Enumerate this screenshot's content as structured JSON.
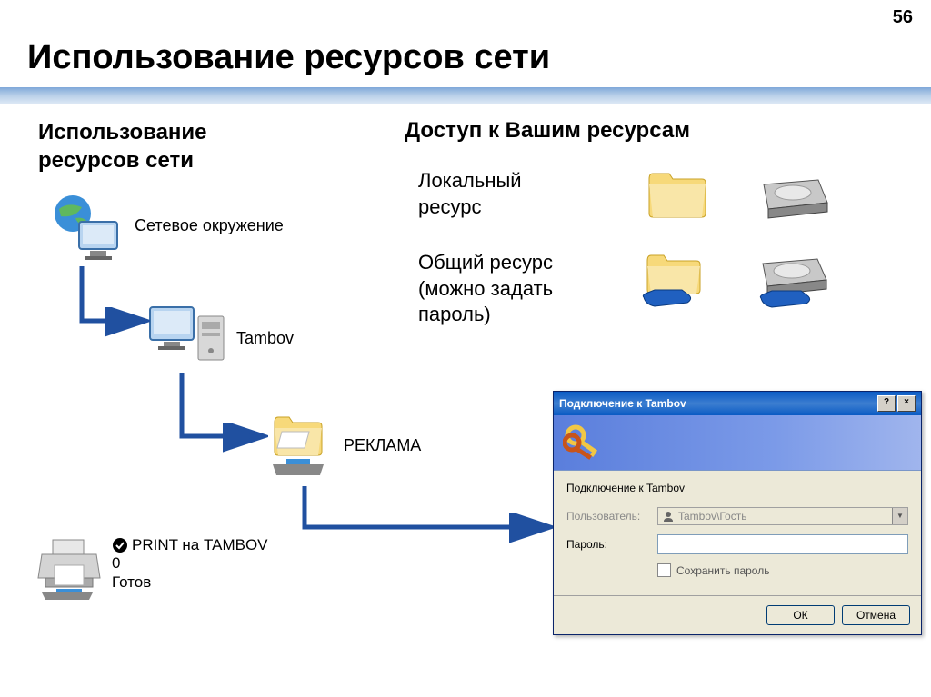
{
  "page_number": "56",
  "main_title": "Использование ресурсов сети",
  "subtitle_left": "Использование ресурсов сети",
  "subtitle_right": "Доступ к Вашим ресурсам",
  "resource_local": "Локальный ресурс",
  "resource_shared": "Общий ресурс (можно задать пароль)",
  "tree": {
    "network_env": "Сетевое окружение",
    "computer": "Tambov",
    "share": "РЕКЛАМА"
  },
  "printer": {
    "name": "PRINT на TAMBOV",
    "jobs": "0",
    "status": "Готов"
  },
  "dialog": {
    "title": "Подключение к Tambov",
    "body_title": "Подключение к Tambov",
    "user_label": "Пользователь:",
    "user_value": "Tambov\\Гость",
    "password_label": "Пароль:",
    "save_password": "Сохранить пароль",
    "ok": "ОК",
    "cancel": "Отмена"
  }
}
